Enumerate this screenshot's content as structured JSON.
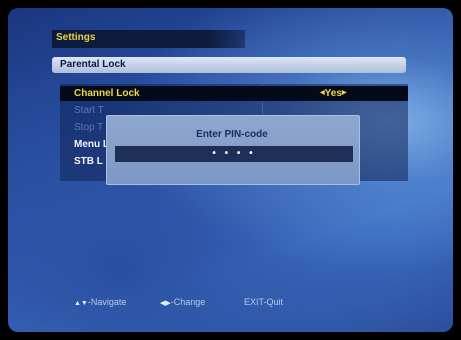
{
  "header": {
    "title": "Settings"
  },
  "submenu": {
    "title": "Parental Lock"
  },
  "menu": {
    "items": [
      {
        "label": "Channel Lock",
        "value": "Yes"
      },
      {
        "label": "Start T"
      },
      {
        "label": "Stop T"
      },
      {
        "label": "Menu L"
      },
      {
        "label": "STB L"
      }
    ]
  },
  "pin_dialog": {
    "title": "Enter PIN-code",
    "value": "• • • •"
  },
  "hints": {
    "navigate": "-Navigate",
    "change": "-Change",
    "exit": "EXIT-Quit"
  },
  "colors": {
    "accent": "#f2d640",
    "background": "#2d57aa",
    "selected_row": "#050a1a"
  }
}
